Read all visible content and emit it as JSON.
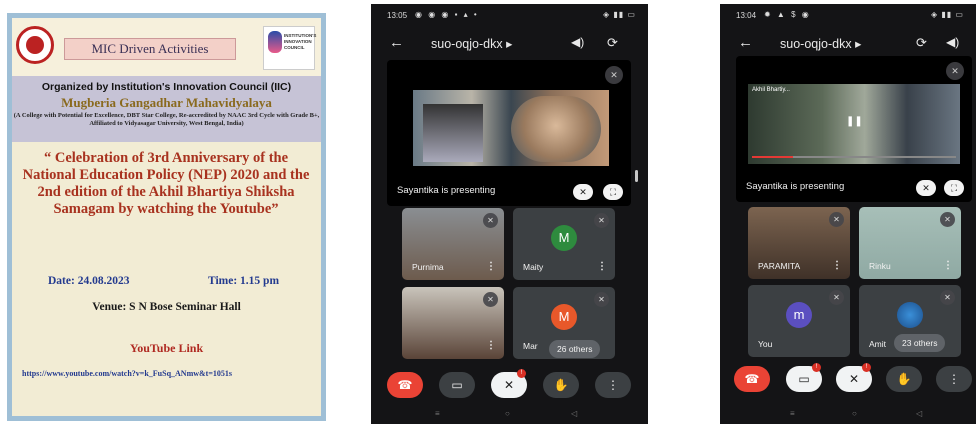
{
  "poster": {
    "mic_title": "MIC Driven Activities",
    "right_logo_text": "INSTITUTION'S INNOVATION COUNCIL",
    "organized_by": "Organized by Institution's Innovation Council (IIC)",
    "college": "Mugberia Gangadhar Mahavidyalaya",
    "college_sub": "(A College with Potential for Excellence, DBT Star College, Re-accredited by NAAC 3rd Cycle with Grade B+, Affiliated to Vidyasagar University, West Bengal, India)",
    "celebration": "“ Celebration of 3rd Anniversary of the National Education Policy (NEP) 2020 and the 2nd edition of the Akhil Bhartiya Shiksha Samagam by watching the Youtube”",
    "date": "Date: 24.08.2023",
    "time": "Time: 1.15 pm",
    "venue": "Venue: S N Bose Seminar Hall",
    "youtube_label": "YouTube Link",
    "url": "https://www.youtube.com/watch?v=k_FuSq_ANmw&t=1051s"
  },
  "phone1": {
    "status_time": "13:05",
    "meeting_code": "suo-oqjo-dkx",
    "presenting_label": "Sayantika is presenting",
    "tiles": [
      {
        "name": "Purnima"
      },
      {
        "name": "Maity",
        "initial": "M"
      },
      {
        "name": ""
      },
      {
        "name": "Mar",
        "initial": "M"
      }
    ],
    "others_count": "26 others"
  },
  "phone2": {
    "status_time": "13:04",
    "meeting_code": "suo-oqjo-dkx",
    "presenting_label": "Sayantika is presenting",
    "video_title": "Akhil Bhartiy...",
    "tiles": [
      {
        "name": "PARAMITA"
      },
      {
        "name": "Rinku"
      },
      {
        "name": "You",
        "initial": "m"
      },
      {
        "name": "Amit"
      }
    ],
    "others_count": "23 others"
  },
  "icons": {
    "back": "←",
    "dropdown": "▸",
    "mic_off": "✕",
    "more": "⋮",
    "hand": "✋",
    "hangup": "☎"
  },
  "colors": {
    "hangup": "#ea4335",
    "avatar_green": "#2e8b3e",
    "avatar_orange": "#e8582a",
    "avatar_purple": "#5b4fc0"
  }
}
